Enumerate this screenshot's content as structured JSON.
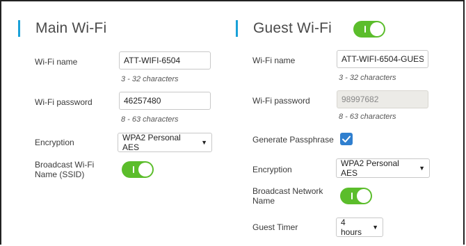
{
  "main_wifi": {
    "title": "Main Wi-Fi",
    "wifi_name_label": "Wi-Fi name",
    "wifi_name_value": "ATT-WIFI-6504",
    "wifi_name_hint": "3 - 32 characters",
    "password_label": "Wi-Fi password",
    "password_value": "46257480",
    "password_hint": "8 - 63 characters",
    "encryption_label": "Encryption",
    "encryption_value": "WPA2 Personal AES",
    "broadcast_label_line1": "Broadcast Wi-Fi",
    "broadcast_label_line2": "Name (SSID)",
    "broadcast_on": true
  },
  "guest_wifi": {
    "title": "Guest Wi-Fi",
    "enabled": true,
    "wifi_name_label": "Wi-Fi name",
    "wifi_name_value": "ATT-WIFI-6504-GUES",
    "wifi_name_hint": "3 - 32 characters",
    "password_label": "Wi-Fi password",
    "password_value": "98997682",
    "password_hint": "8 - 63 characters",
    "generate_label": "Generate Passphrase",
    "generate_checked": true,
    "encryption_label": "Encryption",
    "encryption_value": "WPA2 Personal AES",
    "broadcast_label_line1": "Broadcast Network",
    "broadcast_label_line2": "Name",
    "broadcast_on": true,
    "timer_label": "Guest Timer",
    "timer_value": "4 hours"
  },
  "colors": {
    "accent": "#1aa1d8",
    "toggle_on": "#5bbd2b",
    "checkbox": "#2f7fcf"
  },
  "icons": {
    "dropdown": "caret-down-icon",
    "check": "checkmark-icon"
  }
}
